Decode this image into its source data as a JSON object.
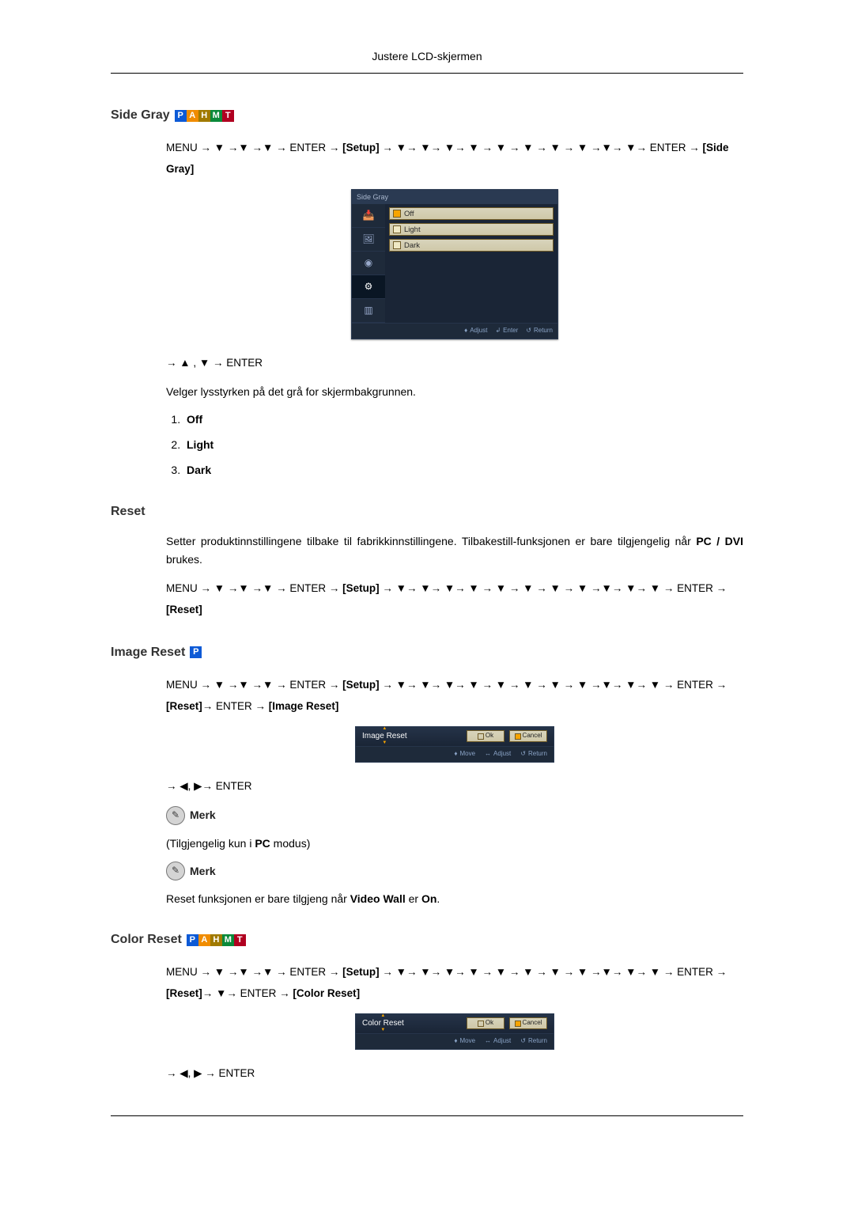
{
  "header": {
    "title": "Justere LCD-skjermen"
  },
  "sections": {
    "sideGray": {
      "title": "Side Gray",
      "path_parts": [
        "MENU → ▼ →▼ →▼ → ENTER → ",
        "[Setup]",
        " → ▼→ ▼→ ▼→ ▼ → ▼ → ▼ → ▼ → ▼ →▼→ ▼→ ENTER → ",
        "[Side Gray]"
      ],
      "osd": {
        "tabTitle": "Side Gray",
        "rows": [
          {
            "id": "off",
            "label": "Off",
            "selected": true
          },
          {
            "id": "light",
            "label": "Light",
            "selected": false
          },
          {
            "id": "dark",
            "label": "Dark",
            "selected": false
          }
        ],
        "footer": {
          "adjust": "Adjust",
          "enter": "Enter",
          "return": "Return"
        }
      },
      "after_path": "→ ▲ , ▼ → ENTER",
      "desc": "Velger lysstyrken på det grå for skjermbakgrunnen.",
      "options": [
        "Off",
        "Light",
        "Dark"
      ]
    },
    "reset": {
      "title": "Reset",
      "desc_pre": "Setter produktinnstillingene tilbake til fabrikkinnstillingene. Tilbakestill-funksjonen er bare tilgjengelig når ",
      "desc_bold": "PC / DVI",
      "desc_post": " brukes.",
      "path_parts": [
        "MENU → ▼ →▼ →▼ → ENTER → ",
        "[Setup]",
        " → ▼→ ▼→ ▼→ ▼ → ▼ → ▼ → ▼ → ▼ →▼→ ▼→ ▼ → ENTER → ",
        "[Reset]"
      ]
    },
    "imageReset": {
      "title": "Image Reset",
      "path_parts": [
        "MENU → ▼ →▼ →▼ → ENTER → ",
        "[Setup]",
        " → ▼→ ▼→ ▼→ ▼ → ▼ → ▼ → ▼ → ▼ →▼→ ▼→ ▼ → ENTER → ",
        "[Reset]",
        "→ ENTER → ",
        "[Image Reset]"
      ],
      "dialog": {
        "title": "Image Reset",
        "ok": "Ok",
        "cancel": "Cancel",
        "footer": {
          "move": "Move",
          "adjust": "Adjust",
          "return": "Return"
        }
      },
      "after_path": "→ ◀, ▶→ ENTER",
      "note_label": "Merk",
      "note1_pre": "(Tilgjengelig kun i ",
      "note1_bold": "PC",
      "note1_post": " modus)",
      "note2_pre": "Reset funksjonen er bare tilgjeng når ",
      "note2_bold": "Video Wall",
      "note2_mid": " er ",
      "note2_bold2": "On",
      "note2_post": "."
    },
    "colorReset": {
      "title": "Color Reset",
      "path_parts": [
        "MENU → ▼ →▼ →▼ → ENTER → ",
        "[Setup]",
        " → ▼→ ▼→ ▼→ ▼ → ▼ → ▼ → ▼ → ▼ →▼→ ▼→ ▼ → ENTER → ",
        "[Reset]",
        "→ ▼→ ENTER → ",
        "[Color Reset]"
      ],
      "dialog": {
        "title": "Color Reset",
        "ok": "Ok",
        "cancel": "Cancel",
        "footer": {
          "move": "Move",
          "adjust": "Adjust",
          "return": "Return"
        }
      },
      "after_path": "→ ◀, ▶ → ENTER"
    }
  },
  "modes": {
    "p": "P",
    "a": "A",
    "h": "H",
    "m": "M",
    "t": "T"
  }
}
